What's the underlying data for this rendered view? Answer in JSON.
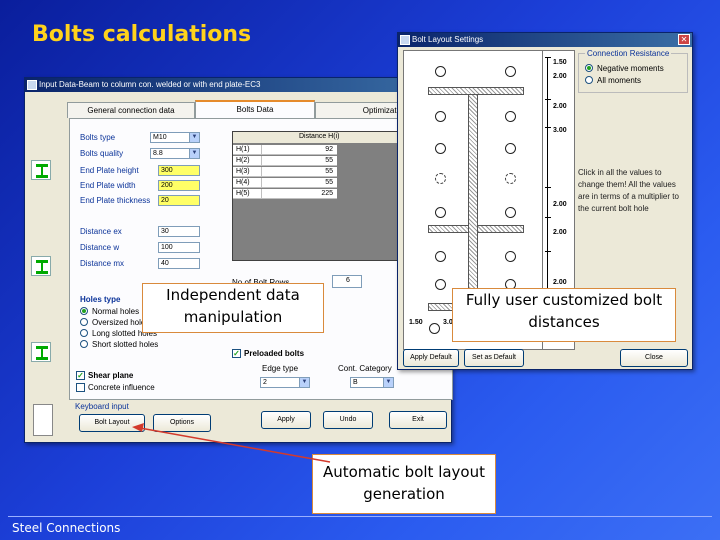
{
  "slide": {
    "title": "Bolts calculations",
    "footer": "Steel Connections"
  },
  "input_dialog": {
    "title": "Input Data-Beam to column con. welded or with end plate-EC3",
    "tabs": [
      "General connection data",
      "Bolts Data",
      "Optimization"
    ],
    "active_tab": "Bolts Data",
    "fields": [
      {
        "label": "Bolts type",
        "value": "M10",
        "kind": "combo"
      },
      {
        "label": "Bolts quality",
        "value": "8.8",
        "kind": "combo"
      },
      {
        "label": "End Plate height",
        "value": "300",
        "kind": "yellow"
      },
      {
        "label": "End Plate width",
        "value": "200",
        "kind": "yellow"
      },
      {
        "label": "End Plate thickness",
        "value": "20",
        "kind": "yellow"
      },
      {
        "label": "Distance ex",
        "value": "30",
        "kind": "text"
      },
      {
        "label": "Distance w",
        "value": "100",
        "kind": "text"
      },
      {
        "label": "Distance mx",
        "value": "40",
        "kind": "text"
      }
    ],
    "distance_table": {
      "header": "Distance H(i)",
      "rows": [
        {
          "key": "H(1)",
          "value": "92"
        },
        {
          "key": "H(2)",
          "value": "55"
        },
        {
          "key": "H(3)",
          "value": "55"
        },
        {
          "key": "H(4)",
          "value": "55"
        },
        {
          "key": "H(5)",
          "value": "225"
        }
      ]
    },
    "bolt_rows_label": "No of Bolt Rows",
    "bolt_rows_value": "6",
    "holes_type_label": "Holes type",
    "holes_options": [
      "Normal holes",
      "Oversized holes",
      "Long slotted holes",
      "Short slotted holes"
    ],
    "holes_selected": 0,
    "preloaded_label": "Preloaded bolts",
    "edge_type_label": "Edge type",
    "edge_type_value": "2",
    "cont_category_label": "Cont. Category",
    "cont_category_value": "B",
    "shear_plane_label": "Shear plane",
    "concrete_label": "Concrete influence",
    "keyboard_label": "Keyboard input",
    "buttons": {
      "bolt_layout": "Bolt Layout",
      "options": "Options",
      "apply": "Apply",
      "undo": "Undo",
      "exit": "Exit"
    }
  },
  "layout_dialog": {
    "title": "Bolt Layout Settings",
    "right_dims": [
      "1.50",
      "2.00",
      "2.00",
      "3.00",
      "2.00",
      "2.00",
      "2.00"
    ],
    "bottom_dims": [
      "1.50",
      "3.00"
    ],
    "connection_resistance": {
      "legend": "Connection Resistance",
      "options": [
        "Negative moments",
        "All moments"
      ],
      "selected": 0
    },
    "help_text": "Click in all the values to change them! All the values are in terms of a multiplier to the current bolt hole",
    "buttons": {
      "apply_default": "Apply Default",
      "set_default": "Set as Default",
      "close": "Close"
    },
    "close_glyph": "✕"
  },
  "callouts": {
    "independent": "Independent data manipulation",
    "custom": "Fully user customized bolt distances",
    "automatic": "Automatic bolt layout generation"
  },
  "colors": {
    "title": "#ffd21c",
    "callout_border": "#d98a3c",
    "pointer": "#d33a2c"
  }
}
